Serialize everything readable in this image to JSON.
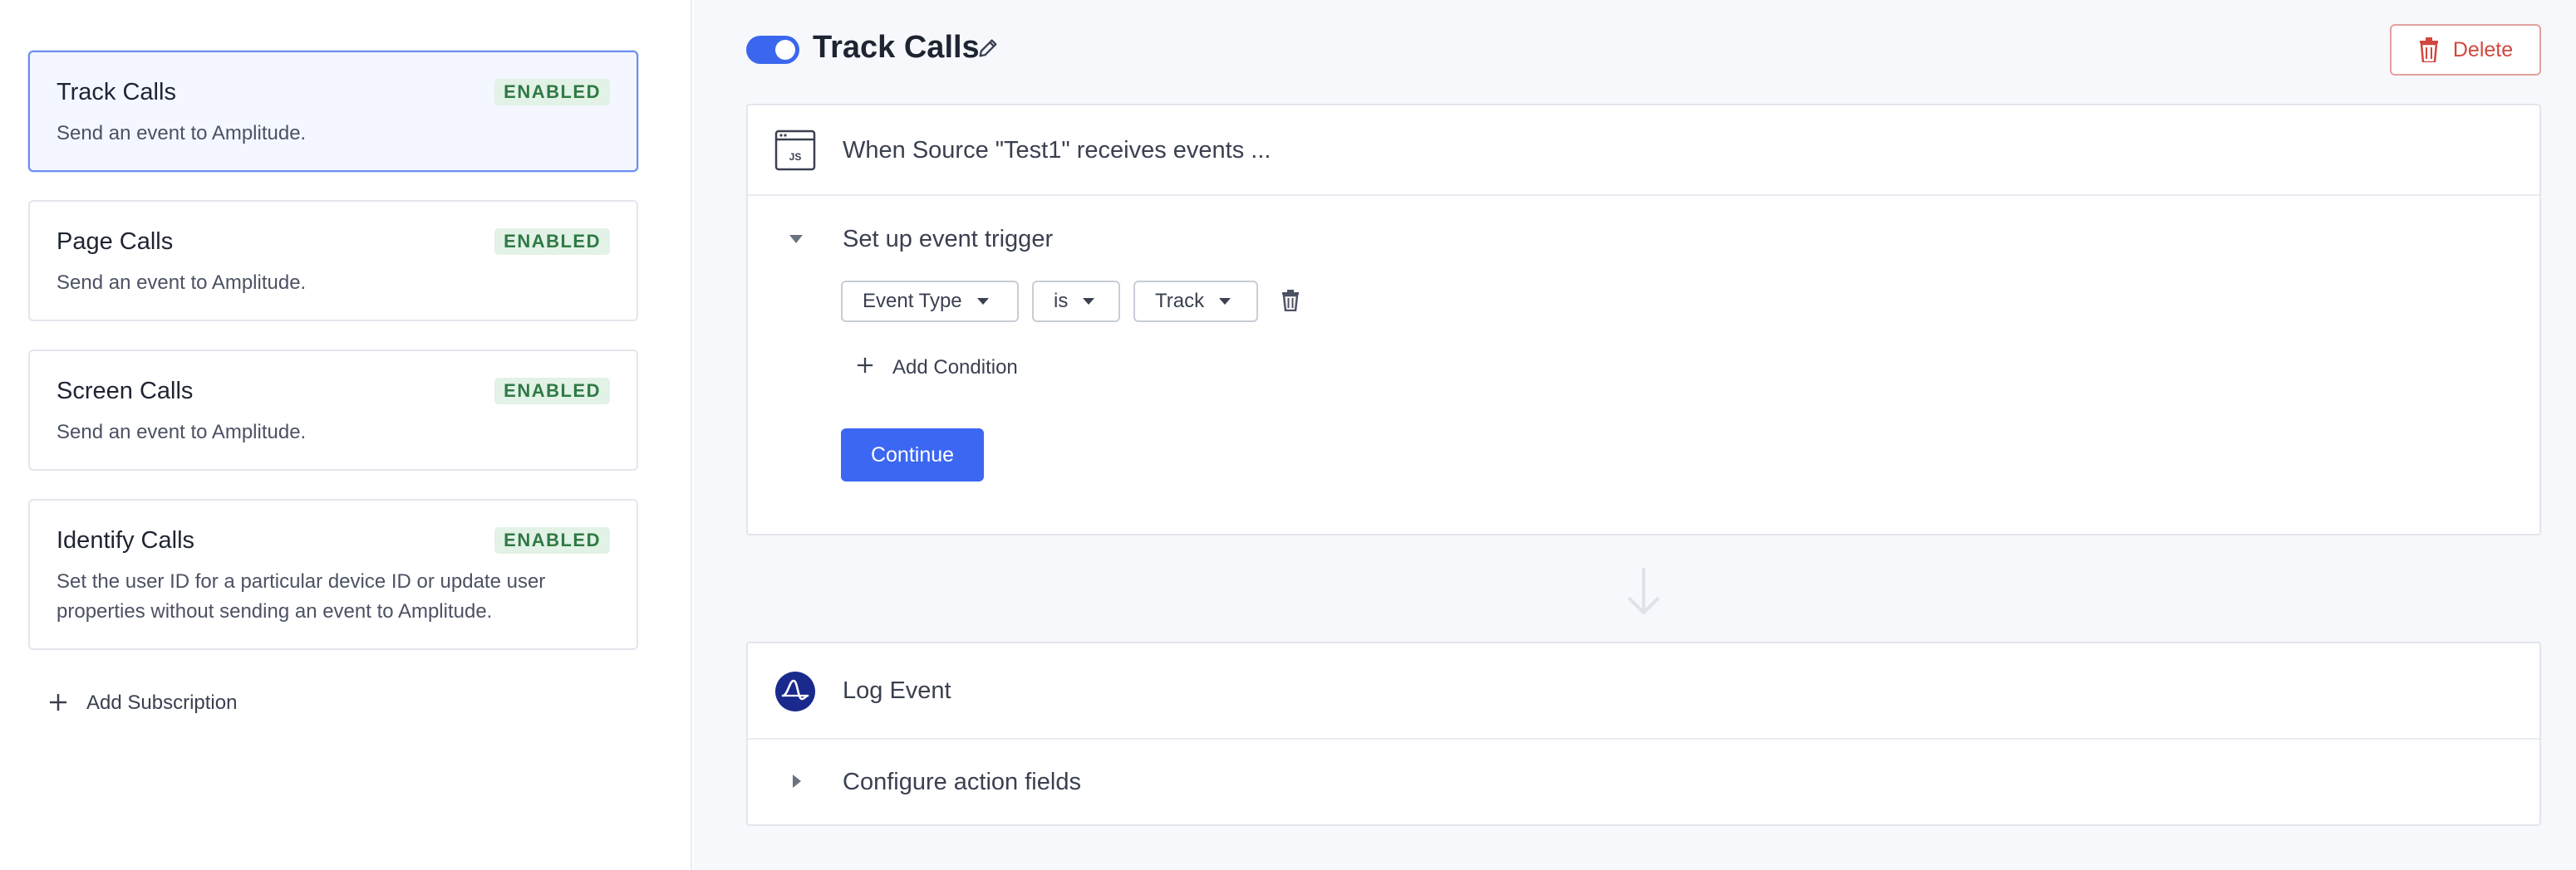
{
  "sidebar": {
    "subscriptions": [
      {
        "title": "Track Calls",
        "badge": "ENABLED",
        "description": "Send an event to Amplitude."
      },
      {
        "title": "Page Calls",
        "badge": "ENABLED",
        "description": "Send an event to Amplitude."
      },
      {
        "title": "Screen Calls",
        "badge": "ENABLED",
        "description": "Send an event to Amplitude."
      },
      {
        "title": "Identify Calls",
        "badge": "ENABLED",
        "description": "Set the user ID for a particular device ID or update user properties without sending an event to Amplitude."
      }
    ],
    "add_subscription_label": "Add Subscription"
  },
  "header": {
    "title": "Track Calls",
    "enabled": true,
    "delete_label": "Delete"
  },
  "trigger_panel": {
    "source_text": "When Source \"Test1\" receives events ...",
    "source_icon_text": "JS",
    "section_title": "Set up event trigger",
    "condition": {
      "field": "Event Type",
      "operator": "is",
      "value": "Track"
    },
    "add_condition_label": "Add Condition",
    "continue_label": "Continue"
  },
  "action_panel": {
    "action_name": "Log Event",
    "configure_label": "Configure action fields"
  },
  "colors": {
    "accent": "#3b67f2",
    "enabled_badge_bg": "#e2f2e6",
    "enabled_badge_text": "#2f7a45",
    "danger": "#d0473f",
    "amplitude_brand": "#1a2a8c"
  }
}
